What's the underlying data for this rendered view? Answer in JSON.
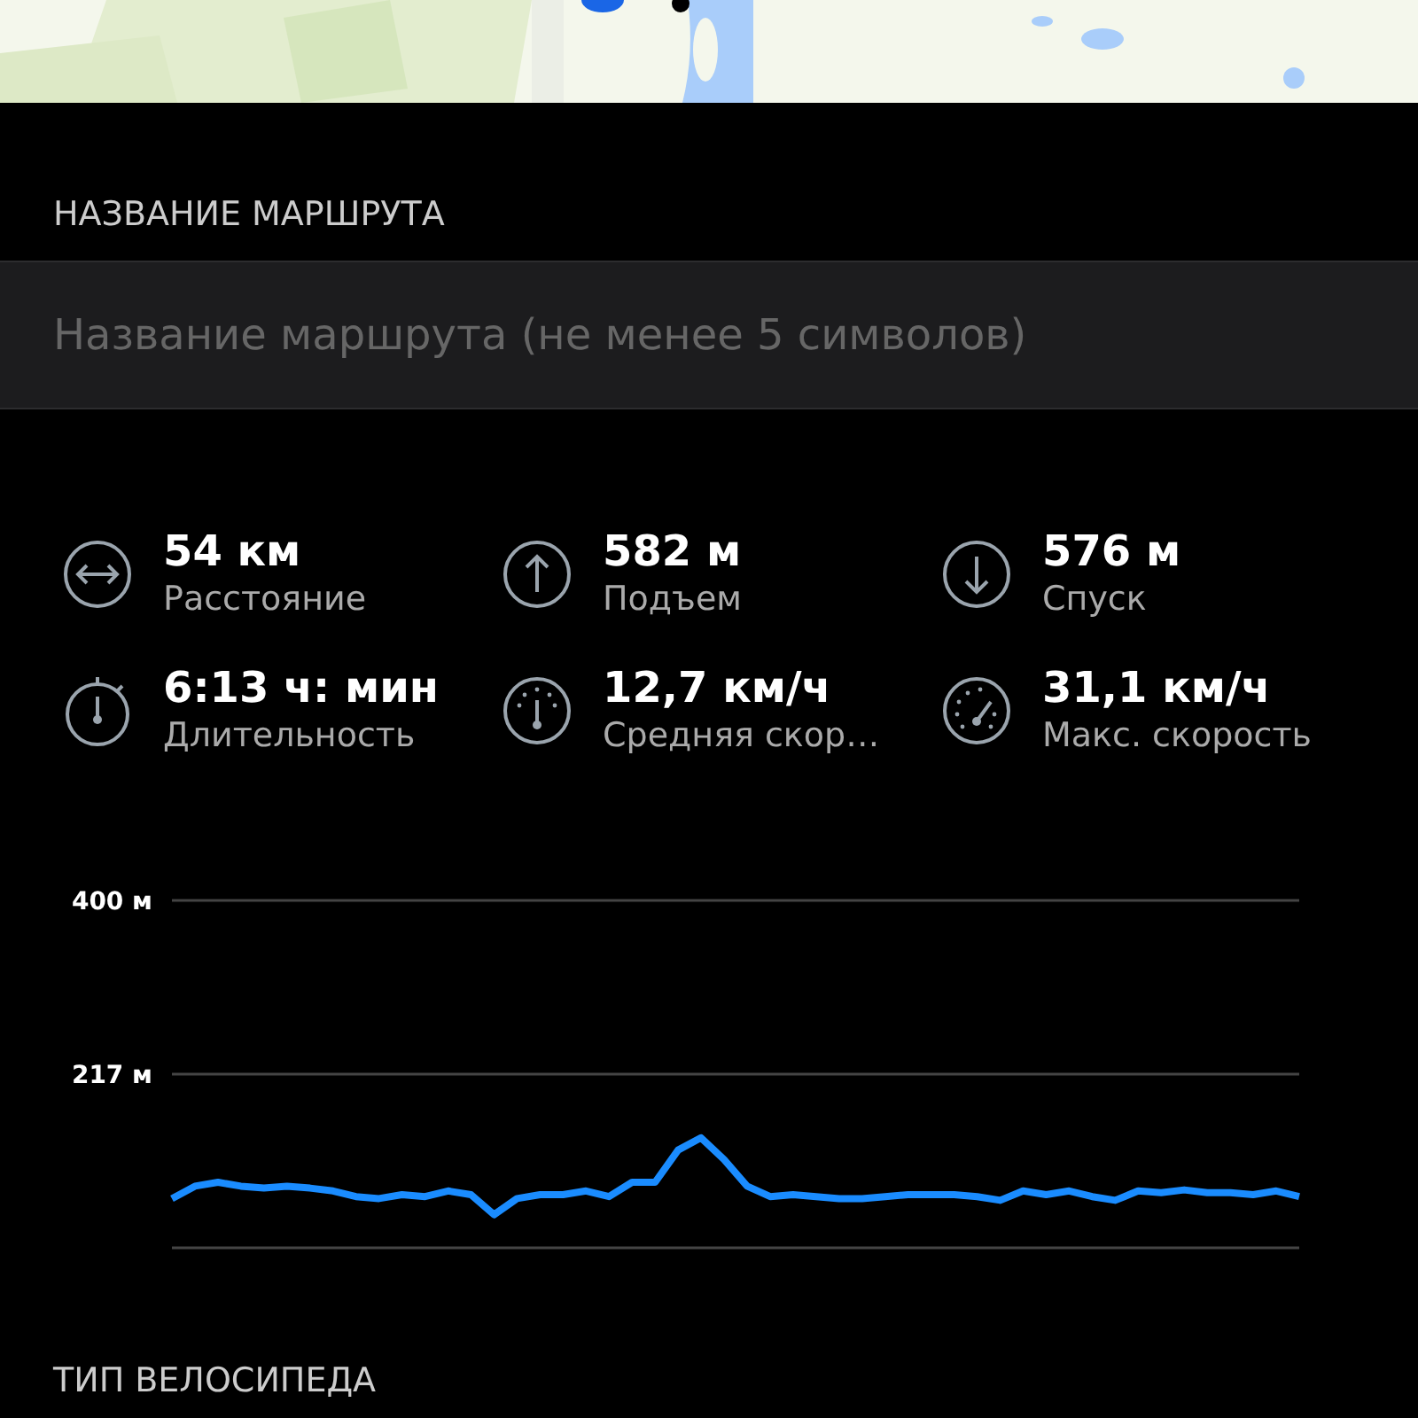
{
  "route_name": {
    "label": "НАЗВАНИЕ МАРШРУТА",
    "placeholder": "Название маршрута (не менее 5 символов)"
  },
  "stats": [
    {
      "kind": "distance",
      "value": "54 км",
      "label": "Расстояние"
    },
    {
      "kind": "ascent",
      "value": "582 м",
      "label": "Подъем"
    },
    {
      "kind": "descent",
      "value": "576 м",
      "label": "Спуск"
    },
    {
      "kind": "duration",
      "value": "6:13  ч: мин",
      "label": "Длительность"
    },
    {
      "kind": "avg_speed",
      "value": "12,7 км/ч",
      "label": "Средняя скор…"
    },
    {
      "kind": "max_speed",
      "value": "31,1 км/ч",
      "label": "Макс. скорость"
    }
  ],
  "elevation": {
    "chart_data": {
      "type": "line",
      "ylim": [
        34,
        400
      ],
      "yticks": [
        {
          "value": 217,
          "label": "217 м"
        },
        {
          "value": 400,
          "label": "400 м"
        }
      ],
      "series": [
        {
          "color": "#1a8cff",
          "values": [
            86,
            99,
            103,
            99,
            97,
            99,
            97,
            94,
            88,
            86,
            90,
            88,
            94,
            90,
            69,
            86,
            90,
            90,
            94,
            88,
            103,
            103,
            137,
            150,
            127,
            99,
            88,
            90,
            88,
            86,
            86,
            88,
            90,
            90,
            90,
            88,
            84,
            94,
            90,
            94,
            88,
            84,
            94,
            92,
            95,
            92,
            92,
            90,
            94,
            88
          ]
        }
      ]
    }
  },
  "bike_type": {
    "label": "ТИП ВЕЛОСИПЕДА"
  }
}
